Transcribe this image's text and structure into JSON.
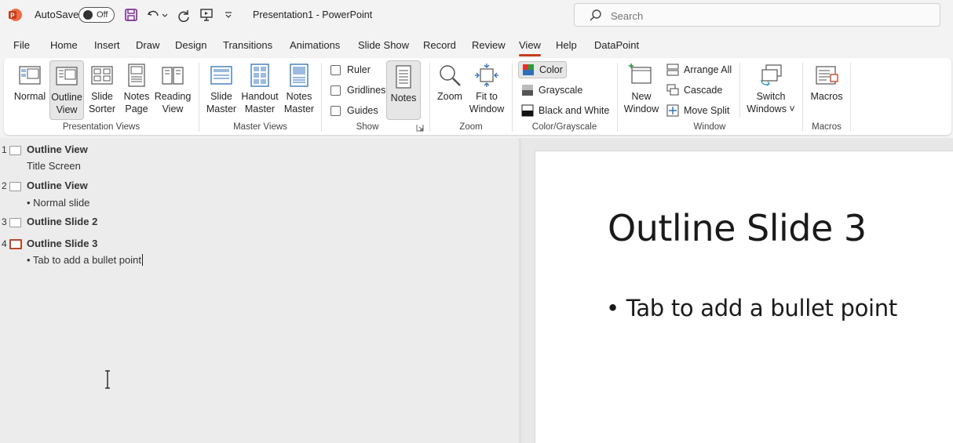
{
  "titlebar": {
    "autosave_label": "AutoSave",
    "autosave_state": "Off",
    "document_title": "Presentation1  -  PowerPoint"
  },
  "search": {
    "placeholder": "Search"
  },
  "tabs": [
    "File",
    "Home",
    "Insert",
    "Draw",
    "Design",
    "Transitions",
    "Animations",
    "Slide Show",
    "Record",
    "Review",
    "View",
    "Help",
    "DataPoint"
  ],
  "active_tab": "View",
  "ribbon": {
    "presentation_views": {
      "label": "Presentation Views",
      "normal": "Normal",
      "outline_1": "Outline",
      "outline_2": "View",
      "sorter_1": "Slide",
      "sorter_2": "Sorter",
      "notespage_1": "Notes",
      "notespage_2": "Page",
      "reading_1": "Reading",
      "reading_2": "View"
    },
    "master_views": {
      "label": "Master Views",
      "slide_1": "Slide",
      "slide_2": "Master",
      "handout_1": "Handout",
      "handout_2": "Master",
      "notes_1": "Notes",
      "notes_2": "Master"
    },
    "show": {
      "label": "Show",
      "ruler": "Ruler",
      "gridlines": "Gridlines",
      "guides": "Guides",
      "notes": "Notes"
    },
    "zoom": {
      "label": "Zoom",
      "zoom": "Zoom",
      "fit_1": "Fit to",
      "fit_2": "Window"
    },
    "color": {
      "label": "Color/Grayscale",
      "color": "Color",
      "grayscale": "Grayscale",
      "bw": "Black and White"
    },
    "window": {
      "label": "Window",
      "new_1": "New",
      "new_2": "Window",
      "arrange_all": "Arrange All",
      "cascade": "Cascade",
      "move_split": "Move Split",
      "switch_1": "Switch",
      "switch_2": "Windows ˅"
    },
    "macros": {
      "label": "Macros",
      "macros": "Macros"
    }
  },
  "outline": {
    "slides": [
      {
        "num": "1",
        "title": "Outline View",
        "body": "Title Screen"
      },
      {
        "num": "2",
        "title": "Outline View",
        "body": "• Normal slide"
      },
      {
        "num": "3",
        "title": "Outline Slide 2",
        "body": ""
      },
      {
        "num": "4",
        "title": "Outline Slide 3",
        "body": "• Tab to add a bullet point"
      }
    ]
  },
  "slide": {
    "title": "Outline Slide 3",
    "bullet": "• Tab to add a bullet point"
  },
  "colors": {
    "accent": "#c43e1c",
    "current_slide_border": "#b7472a"
  }
}
